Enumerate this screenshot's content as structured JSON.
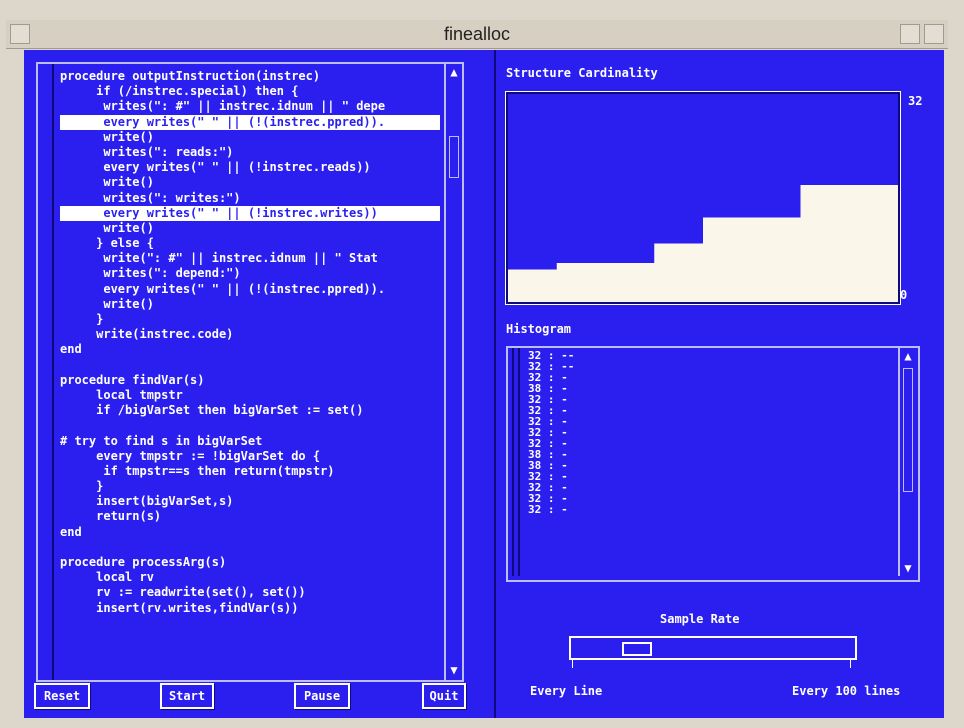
{
  "window": {
    "title": "finealloc"
  },
  "code": {
    "lines": [
      "procedure outputInstruction(instrec)",
      "     if (/instrec.special) then {",
      "      writes(\": #\" || instrec.idnum || \" depe",
      "      every writes(\" \" || (!(instrec.ppred)).",
      "      write()",
      "      writes(\": reads:\")",
      "      every writes(\" \" || (!instrec.reads))",
      "      write()",
      "      writes(\": writes:\")",
      "      every writes(\" \" || (!instrec.writes))",
      "      write()",
      "     } else {",
      "      write(\": #\" || instrec.idnum || \" Stat",
      "      writes(\": depend:\")",
      "      every writes(\" \" || (!(instrec.ppred)).",
      "      write()",
      "     }",
      "     write(instrec.code)",
      "end",
      "",
      "procedure findVar(s)",
      "     local tmpstr",
      "     if /bigVarSet then bigVarSet := set()",
      "",
      "# try to find s in bigVarSet",
      "     every tmpstr := !bigVarSet do {",
      "      if tmpstr==s then return(tmpstr)",
      "     }",
      "     insert(bigVarSet,s)",
      "     return(s)",
      "end",
      "",
      "procedure processArg(s)",
      "     local rv",
      "     rv := readwrite(set(), set())",
      "     insert(rv.writes,findVar(s))"
    ],
    "highlighted": [
      3,
      9
    ]
  },
  "buttons": {
    "reset": "Reset",
    "start": "Start",
    "pause": "Pause",
    "quit": "Quit"
  },
  "chart": {
    "heading": "Structure Cardinality",
    "y_max_label": "32",
    "y_min_label": "0"
  },
  "chart_data": {
    "type": "area",
    "title": "Structure Cardinality",
    "ylim": [
      0,
      32
    ],
    "x": [
      0,
      1,
      2,
      3,
      4,
      5,
      6,
      7
    ],
    "values": [
      5,
      6,
      6,
      9,
      13,
      13,
      18,
      18
    ]
  },
  "histogram": {
    "heading": "Histogram",
    "rows": [
      "32 : --",
      "32 : --",
      "32 : -",
      "38 : -",
      "32 : -",
      "32 : -",
      "32 : -",
      "32 : -",
      "32 : -",
      "38 : -",
      "38 : -",
      "32 : -",
      "32 : -",
      "32 : -",
      "32 : -"
    ]
  },
  "sample": {
    "heading": "Sample Rate",
    "min_label": "Every Line",
    "max_label": "Every 100 lines",
    "level": 0.2
  },
  "colors": {
    "panel": "#2b1ff0",
    "text": "#ffffff",
    "chart_fill": "#fbf6ea"
  }
}
